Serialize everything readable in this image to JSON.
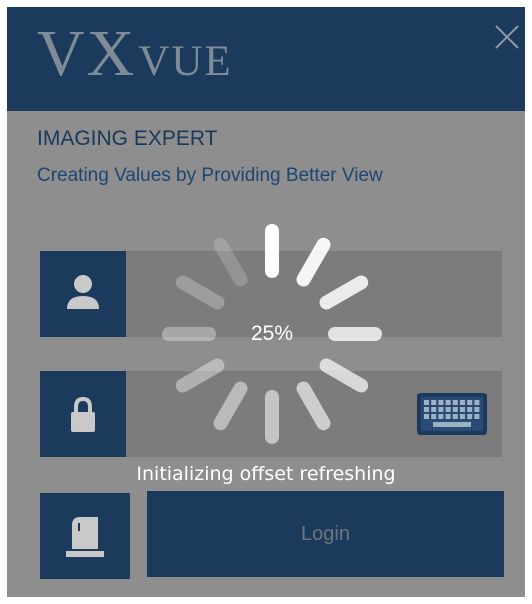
{
  "header": {
    "logo_vx": "VX",
    "logo_vue": "VUE"
  },
  "title": "IMAGING EXPERT",
  "subtitle": "Creating Values by Providing Better View",
  "login": {
    "button_label": "Login"
  },
  "loading": {
    "progress_text": "25%",
    "progress_value": 0.25,
    "status": "Initializing offset refreshing"
  },
  "colors": {
    "navy": "#1b3a5c",
    "overlay_gray": "#8e8e8e",
    "text_blue": "#18385c"
  },
  "icons": {
    "close": "close-icon",
    "user": "user-icon",
    "lock": "lock-icon",
    "keyboard": "keyboard-icon",
    "device": "sensor-device-icon"
  }
}
